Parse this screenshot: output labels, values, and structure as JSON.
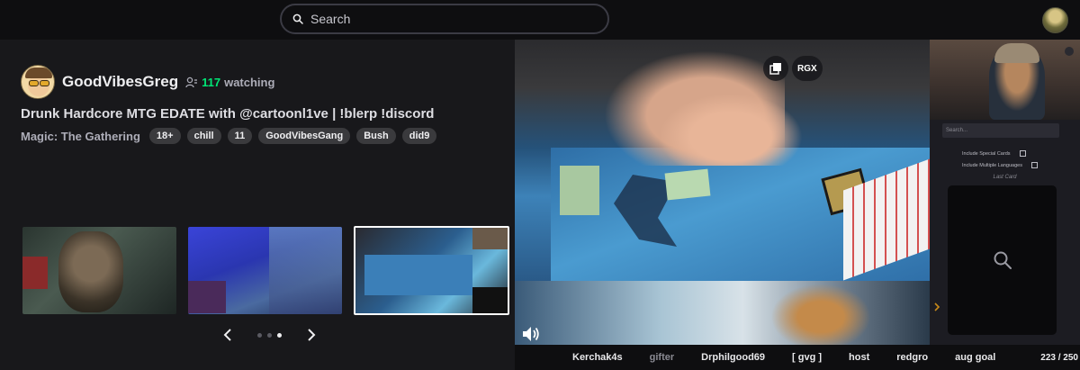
{
  "search": {
    "placeholder": "Search"
  },
  "streamer": {
    "name": "GoodVibesGreg",
    "viewer_count": "117",
    "viewer_label": "watching",
    "title": "Drunk Hardcore MTG EDATE with @cartoonl1ve | !blerp !discord",
    "category": "Magic: The Gathering",
    "tags": [
      "18+",
      "chill",
      "11",
      "GoodVibesGang",
      "Bush",
      "did9"
    ]
  },
  "carousel": {
    "page_count": 3,
    "active_index": 2
  },
  "overlay": {
    "rgx_label": "RGX"
  },
  "widget": {
    "search_placeholder": "Search...",
    "option_special": "Include Special Cards",
    "option_languages": "Include Multiple Languages",
    "last_card_label": "Last Card"
  },
  "ticker": {
    "items": [
      "Kerchak4s",
      "gifter",
      "Drphilgood69",
      "[ gvg ]",
      "host",
      "redgro",
      "aug goal"
    ],
    "progress": "223 / 250"
  },
  "colors": {
    "accent_green": "#00e676",
    "background": "#0e0e10",
    "panel": "#18181b"
  }
}
